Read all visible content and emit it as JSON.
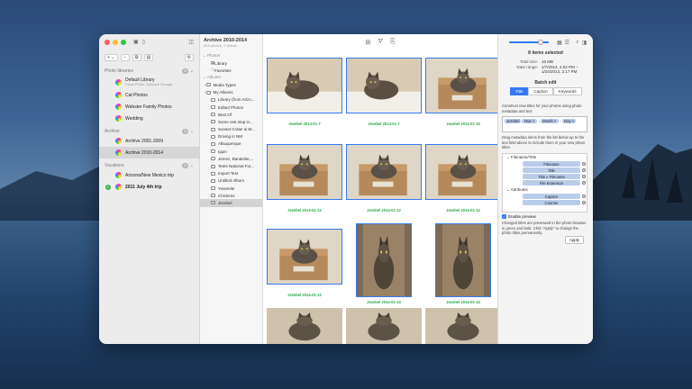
{
  "desktop": {
    "colors": {
      "sky": "#3d6494",
      "water": "#23466e"
    }
  },
  "window": {
    "library_pane": {
      "groups": [
        {
          "name": "Photo libraries",
          "badges": [
            "4"
          ],
          "items": [
            {
              "label": "Default Library",
              "sublabel": "Cloud Photo, Optimize Storage",
              "selected": false
            },
            {
              "label": "Cat Photos",
              "sublabel": "",
              "selected": false
            },
            {
              "label": "Webster Family Photos",
              "sublabel": "",
              "selected": false
            },
            {
              "label": "Wedding",
              "sublabel": "",
              "selected": false
            }
          ]
        },
        {
          "name": "Archive",
          "badges": [
            "2"
          ],
          "items": [
            {
              "label": "Archive 2001-2009",
              "sublabel": "",
              "selected": false
            },
            {
              "label": "Archive 2010-2014",
              "sublabel": "",
              "selected": true
            }
          ]
        },
        {
          "name": "Vacations",
          "badges": [
            "2"
          ],
          "items": [
            {
              "label": "Arizona/New Mexico trip",
              "sublabel": "",
              "selected": false
            },
            {
              "label": "2011 July 4th trip",
              "sublabel": "",
              "selected": false,
              "bold": true,
              "checked": true
            }
          ]
        }
      ],
      "toolbar": {
        "add": "+ ⌄",
        "remove": "−"
      }
    },
    "album_pane": {
      "title": "Archive 2010-2014",
      "subtitle": "815 photos, 7 videos",
      "photos_section": "Photos",
      "photos_items": [
        "Library",
        "Favorites"
      ],
      "albums_section": "Albums",
      "albums_items": [
        {
          "label": "Media Types",
          "level": 1
        },
        {
          "label": "My Albums",
          "level": 1
        },
        {
          "label": "Library (from Arizo...",
          "level": 2
        },
        {
          "label": "Edited Photos",
          "level": 2
        },
        {
          "label": "Best Of",
          "level": 2
        },
        {
          "label": "Some rest stop in...",
          "level": 2
        },
        {
          "label": "Sunset Crater & W...",
          "level": 2
        },
        {
          "label": "Driving in NM",
          "level": 2
        },
        {
          "label": "Albuquerque",
          "level": 2
        },
        {
          "label": "Iguin",
          "level": 2
        },
        {
          "label": "Jemez, Bandelier,...",
          "level": 2
        },
        {
          "label": "Tents National For...",
          "level": 2
        },
        {
          "label": "Import Test",
          "level": 2
        },
        {
          "label": "Untitled Album",
          "level": 2
        },
        {
          "label": "Yosemite",
          "level": 2
        },
        {
          "label": "Chickens",
          "level": 2
        },
        {
          "label": "Jezebel",
          "level": 2,
          "selected": true
        }
      ]
    },
    "browser": {
      "photos": [
        {
          "caption": "Jezebel 2014-01-7",
          "scene": "bed"
        },
        {
          "caption": "Jezebel 2014-01-7",
          "scene": "bed"
        },
        {
          "caption": "Jezebel 2014-01-15",
          "scene": "box"
        },
        {
          "caption": "Jezebel 2014-01-12",
          "scene": "box"
        },
        {
          "caption": "Jezebel 2014-01-12",
          "scene": "box"
        },
        {
          "caption": "Jezebel 2014-01-12",
          "scene": "box"
        },
        {
          "caption": "Jezebel 2014-01-12",
          "scene": "box"
        },
        {
          "caption": "Jezebel 2014-01-24",
          "scene": "tall"
        },
        {
          "caption": "Jezebel 2014-01-24",
          "scene": "tall"
        },
        {
          "caption": "",
          "scene": "partial"
        },
        {
          "caption": "",
          "scene": "partial"
        },
        {
          "caption": "",
          "scene": "partial"
        }
      ]
    },
    "inspector": {
      "heading": "8 items selected",
      "total_size_label": "Total size:",
      "total_size_value": "16 MB",
      "date_range_label": "Date range:",
      "date_range_value": "1/7/2014, 4:52 PM – 1/24/2014, 2:17 PM",
      "batch_edit": "Batch edit",
      "tabs": [
        "Title",
        "Caption",
        "Keywords"
      ],
      "active_tab": "Title",
      "instruction": "Construct new titles for your photos using photo metadata and text",
      "tokens": [
        "Jezebel",
        "Year ×",
        "-",
        "Month ×",
        "-",
        "Day ×"
      ],
      "drag_instruction": "Drag metadata items from the list below up to the text field above to include them in your new photo titles.",
      "field_groups": [
        {
          "name": "Filename/Title",
          "items": [
            "Filename",
            "Title",
            "Title ≠ Filename",
            "File Extension"
          ]
        },
        {
          "name": "Attributes",
          "items": [
            "Caption",
            "Counter"
          ]
        }
      ],
      "enable_preview": "Enable preview",
      "preview_note": "Changed titles are previewed in the photo browser in green and bold. Click \"Apply\" to change the photo titles permanently.",
      "apply": "Apply"
    }
  }
}
